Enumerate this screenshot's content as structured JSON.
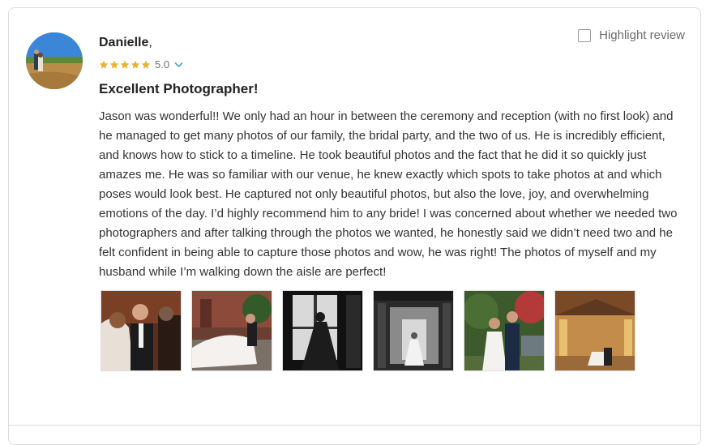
{
  "reviewer": {
    "name": "Danielle",
    "name_suffix": ",",
    "rating": 5.0,
    "rating_text": "5.0",
    "stars": 5,
    "avatar": "reviewer-avatar-photo"
  },
  "highlight": {
    "label": "Highlight review",
    "checked": false
  },
  "review": {
    "title": "Excellent Photographer!",
    "body": "Jason was wonderful!! We only had an hour in between the ceremony and reception (with no first look) and he managed to get many photos of our family, the bridal party, and the two of us. He is incredibly efficient, and knows how to stick to a timeline. He took beautiful photos and the fact that he did it so quickly just amazes me. He was so familiar with our venue, he knew exactly which spots to take photos at and which poses would look best. He captured not only beautiful photos, but also the love, joy, and overwhelming emotions of the day. I’d highly recommend him to any bride! I was concerned about whether we needed two photographers and after talking through the photos we wanted, he honestly said we didn’t need two and he felt confident in being able to capture those photos and wow, he was right! The photos of myself and my husband while I’m walking down the aisle are perfect!"
  },
  "photos": [
    {
      "subject": "ceremony-couple-photo"
    },
    {
      "subject": "garden-kiss-veil-photo"
    },
    {
      "subject": "bride-window-silhouette-photo"
    },
    {
      "subject": "bride-hallway-bw-photo"
    },
    {
      "subject": "couple-garden-photo"
    },
    {
      "subject": "chapel-interior-photo"
    }
  ],
  "colors": {
    "star": "#e8b330",
    "chevron": "#3aa0a8",
    "border": "#dcdcdc",
    "text": "#333333"
  }
}
